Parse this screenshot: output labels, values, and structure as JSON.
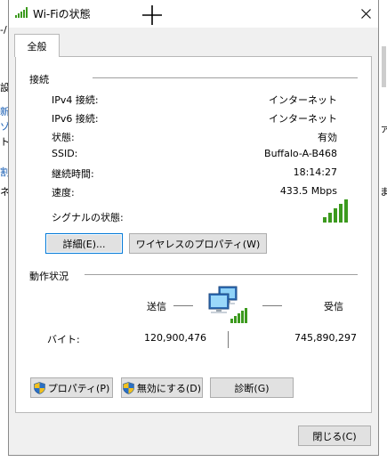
{
  "window": {
    "title": "Wi-Fiの状態",
    "tab_general": "全般"
  },
  "connection": {
    "header": "接続",
    "rows": [
      {
        "label": "IPv4 接続:",
        "value": "インターネット"
      },
      {
        "label": "IPv6 接続:",
        "value": "インターネット"
      },
      {
        "label": "状態:",
        "value": "有効"
      },
      {
        "label": "SSID:",
        "value": "Buffalo-A-B468"
      },
      {
        "label": "継続時間:",
        "value": "18:14:27"
      },
      {
        "label": "速度:",
        "value": "433.5 Mbps"
      }
    ],
    "signal_label": "シグナルの状態:",
    "signal_level": 5,
    "signal_max": 5,
    "details_button": "詳細(E)...",
    "wireless_props_button": "ワイヤレスのプロパティ(W)"
  },
  "activity": {
    "header": "動作状況",
    "sent_label": "送信",
    "received_label": "受信",
    "bytes_label": "バイト:",
    "bytes_sent": "120,900,476",
    "bytes_received": "745,890,297"
  },
  "buttons": {
    "properties": "プロパティ(P)",
    "disable": "無効にする(D)",
    "diagnose": "診断(G)",
    "close": "閉じる(C)"
  },
  "background": {
    "fragments_left": [
      "-/",
      "設",
      "新",
      "ゾ",
      "ト",
      "割",
      "ネ"
    ],
    "fragments_right": [
      "ァ",
      "ま"
    ]
  },
  "colors": {
    "signal_green": "#3c9a1e",
    "shield_blue": "#2a6fc4",
    "shield_yellow": "#f2c01e",
    "focus_blue": "#0078d7"
  }
}
